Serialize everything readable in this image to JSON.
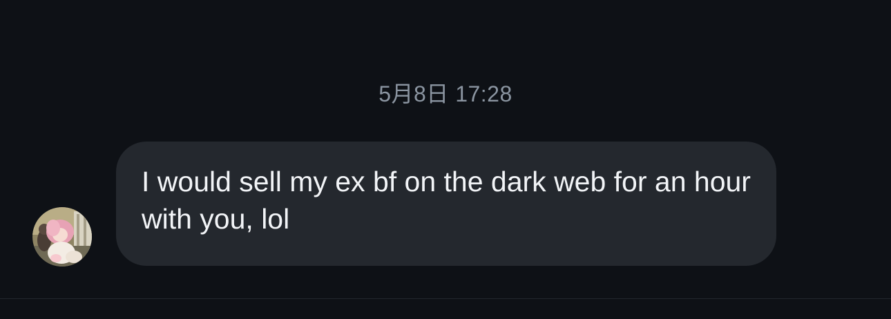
{
  "conversation": {
    "timestamp": "5月8日 17:28",
    "messages": [
      {
        "sender_avatar": "avatar-image",
        "text": "I would sell my ex bf on the dark web for an hour with you, lol"
      }
    ]
  },
  "colors": {
    "background": "#0e1116",
    "bubble": "#24282e",
    "message_text": "#f2f4f7",
    "timestamp_text": "#8b95a1"
  }
}
